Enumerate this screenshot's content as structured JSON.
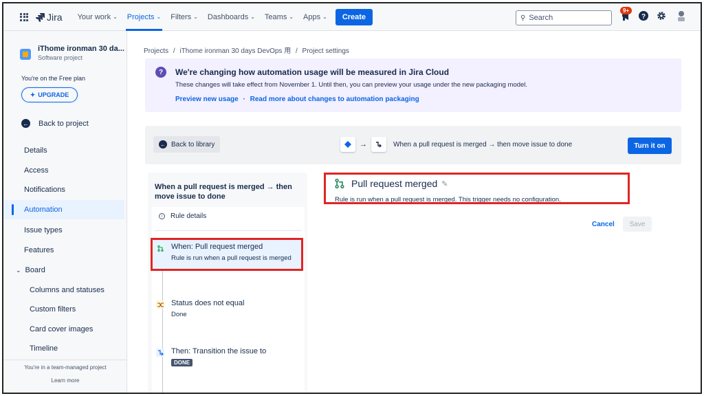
{
  "nav": {
    "logo_text": "Jira",
    "items": [
      {
        "label": "Your work",
        "chevron": "⌄"
      },
      {
        "label": "Projects",
        "chevron": "⌄"
      },
      {
        "label": "Filters",
        "chevron": "⌄"
      },
      {
        "label": "Dashboards",
        "chevron": "⌄"
      },
      {
        "label": "Teams",
        "chevron": "⌄"
      },
      {
        "label": "Apps",
        "chevron": "⌄"
      }
    ],
    "create_label": "Create",
    "search_placeholder": "Search",
    "notification_badge": "9+",
    "accent": "#0c66e4"
  },
  "sidebar": {
    "project_name": "iThome ironman 30 da...",
    "project_type": "Software project",
    "plan_text": "You're on the Free plan",
    "upgrade_label": "UPGRADE",
    "back_label": "Back to project",
    "items": [
      {
        "label": "Details"
      },
      {
        "label": "Access"
      },
      {
        "label": "Notifications"
      },
      {
        "label": "Automation",
        "active": true
      },
      {
        "label": "Issue types"
      },
      {
        "label": "Features"
      },
      {
        "label": "Board",
        "expanded": true
      },
      {
        "label": "Columns and statuses"
      },
      {
        "label": "Custom filters"
      },
      {
        "label": "Card cover images"
      },
      {
        "label": "Timeline"
      }
    ],
    "footer_text": "You're in a team-managed project",
    "learn_more": "Learn more"
  },
  "breadcrumb": {
    "items": [
      "Projects",
      "iThome ironman 30 days DevOps 用",
      "Project settings"
    ],
    "separator": "/"
  },
  "banner": {
    "title": "We're changing how automation usage will be measured in Jira Cloud",
    "body": "These changes will take effect from November 1. Until then, you can preview your usage under the new packaging model.",
    "link1": "Preview new usage",
    "sep": "·",
    "link2": "Read more about changes to automation packaging",
    "bg": "#f3f0ff"
  },
  "toolbar": {
    "back_library": "Back to library",
    "flow_arrow": "→",
    "flow_text": "When a pull request is merged → then move issue to done",
    "turn_on": "Turn it on"
  },
  "rule": {
    "title": "When a pull request is merged → then move issue to done",
    "details_label": "Rule details",
    "steps": [
      {
        "title": "When: Pull request merged",
        "sub": "Rule is run when a pull request is merged",
        "icon": "pull-request-icon"
      },
      {
        "title": "Status does not equal",
        "sub": "Done",
        "icon": "condition-icon"
      },
      {
        "title": "Then: Transition the issue to",
        "lozenge": "DONE",
        "icon": "transition-icon"
      }
    ]
  },
  "trigger": {
    "title": "Pull request merged",
    "desc": "Rule is run when a pull request is merged. This trigger needs no configuration.",
    "cancel": "Cancel",
    "save": "Save"
  },
  "highlight_color": "#e02424"
}
